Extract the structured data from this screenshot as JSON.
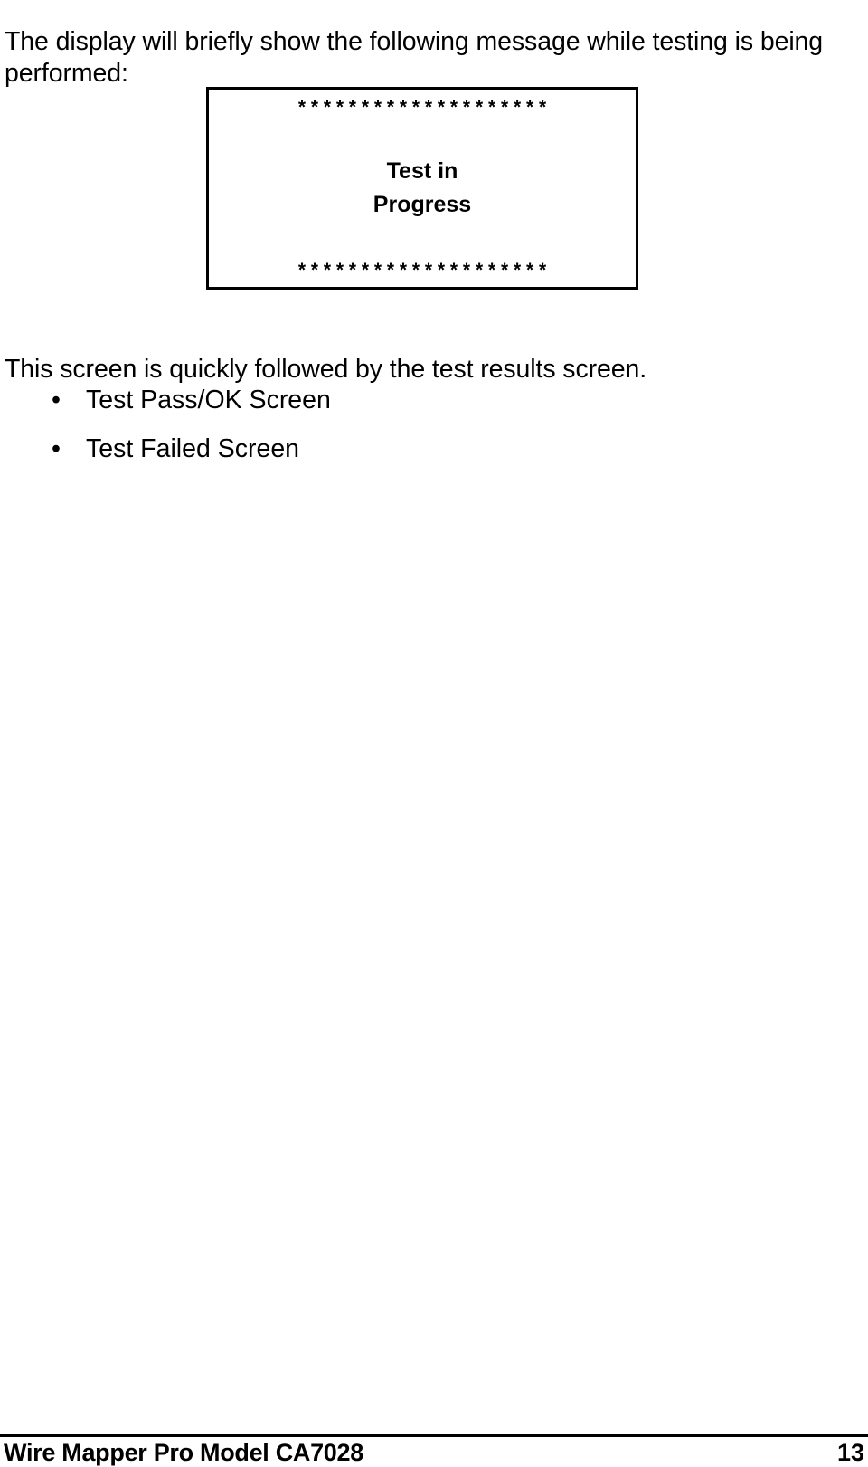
{
  "document": {
    "intro_paragraph": "The display will briefly show the following message while testing is being performed:",
    "followup_paragraph": "This screen is quickly followed by the test results screen."
  },
  "lcd_display": {
    "top_border_row": "* * * * * * * * * * * * * * * * * * * *",
    "bottom_border_row": "* * * * * * * * * * * * * * * * * * * *",
    "message_line_1": "Test in",
    "message_line_2": "Progress",
    "border_color": "#000000",
    "background_color": "#ffffff"
  },
  "bullet_list": {
    "bullet_glyph": "•",
    "items": [
      {
        "label": "Test Pass/OK Screen"
      },
      {
        "label": "Test Failed Screen"
      }
    ]
  },
  "footer": {
    "document_title": "Wire Mapper Pro Model CA7028",
    "page_number": "13"
  }
}
